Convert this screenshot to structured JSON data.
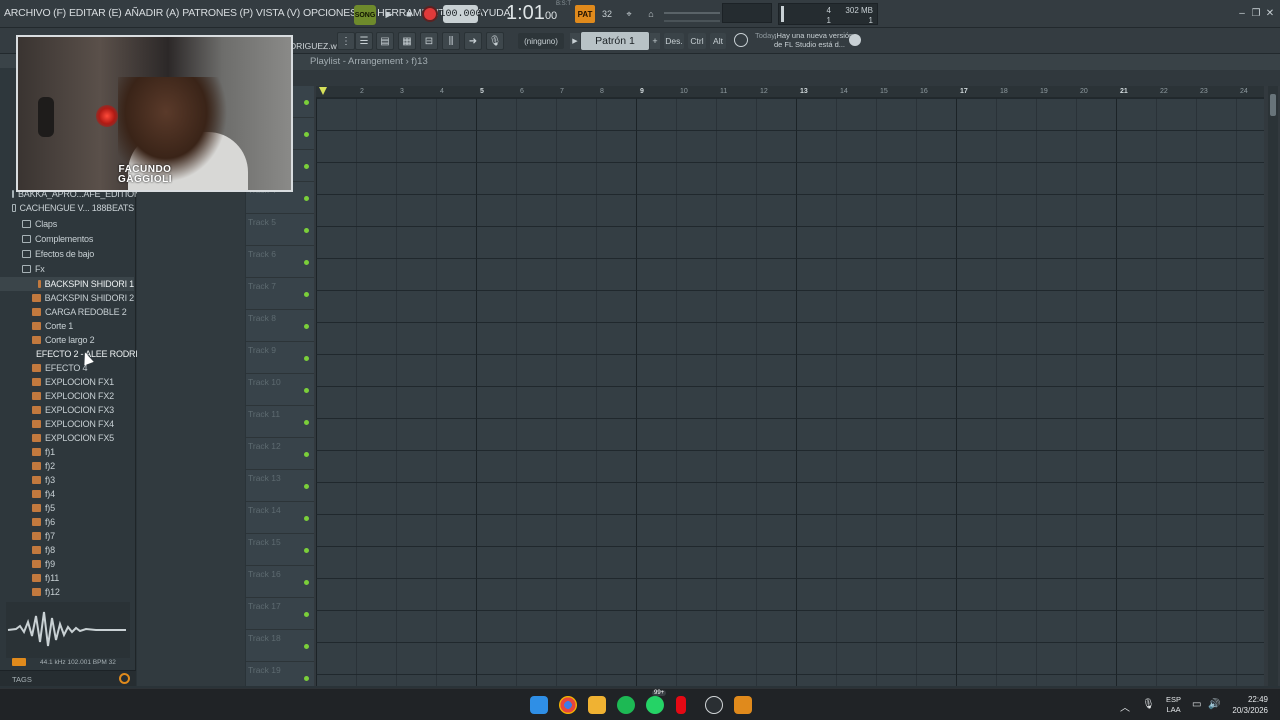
{
  "menu": [
    {
      "label": "ARCHIVO (F)"
    },
    {
      "label": "EDITAR (E)"
    },
    {
      "label": "AÑADIR (A)"
    },
    {
      "label": "PATRONES (P)"
    },
    {
      "label": "VISTA (V)"
    },
    {
      "label": "OPCIONES (O)"
    },
    {
      "label": "HERRAMIENTAS (T)"
    },
    {
      "label": "AYUDA"
    }
  ],
  "transport": {
    "song_label": "SONG",
    "tempo": "100.000",
    "time_main": "1:01",
    "time_sub": "00",
    "bst_label": "B:S:T",
    "metronome_label": "PAT",
    "pattern_count": "32",
    "cpu_value": "4",
    "polyphony": "1",
    "ram": "302 MB",
    "ram_sub": "1"
  },
  "toolbar2": {
    "hint_file": "DRIGUEZ.wav",
    "pattern_none": "(ninguno)",
    "pattern_name": "Patrón 1",
    "des_label": "Des.",
    "ctrl_label": "Ctrl",
    "alt_label": "Alt",
    "news_date": "Today",
    "news_text": "¡Hay una nueva versión de FL Studio está d..."
  },
  "webcam": {
    "name_line1": "FACUNDO",
    "name_line2": "GAGGIOLI"
  },
  "browser": {
    "items": [
      {
        "label": "BAKKA_APRO...AFE_EDITION",
        "type": "folder",
        "indent": 12
      },
      {
        "label": "CACHENGUE V... 188BEATS",
        "type": "folder",
        "indent": 12
      },
      {
        "label": "Claps",
        "type": "folder",
        "indent": 22
      },
      {
        "label": "Complementos",
        "type": "folder",
        "indent": 22
      },
      {
        "label": "Efectos de bajo",
        "type": "folder",
        "indent": 22
      },
      {
        "label": "Fx",
        "type": "folder",
        "indent": 22
      },
      {
        "label": "BACKSPIN SHIDORI 1",
        "type": "file",
        "indent": 38
      },
      {
        "label": "BACKSPIN SHIDORI 2",
        "type": "file",
        "indent": 32
      },
      {
        "label": "CARGA REDOBLE 2",
        "type": "file",
        "indent": 32
      },
      {
        "label": "Corte 1",
        "type": "file",
        "indent": 32
      },
      {
        "label": "Corte largo 2",
        "type": "file",
        "indent": 32
      },
      {
        "label": "EFECTO 2 - ALEE RODRIGUEZ",
        "type": "file",
        "indent": 32
      },
      {
        "label": "EFECTO 4",
        "type": "file",
        "indent": 32
      },
      {
        "label": "EXPLOCION FX1",
        "type": "file",
        "indent": 32
      },
      {
        "label": "EXPLOCION FX2",
        "type": "file",
        "indent": 32
      },
      {
        "label": "EXPLOCION FX3",
        "type": "file",
        "indent": 32
      },
      {
        "label": "EXPLOCION FX4",
        "type": "file",
        "indent": 32
      },
      {
        "label": "EXPLOCION FX5",
        "type": "file",
        "indent": 32
      },
      {
        "label": "f)1",
        "type": "file",
        "indent": 32
      },
      {
        "label": "f)2",
        "type": "file",
        "indent": 32
      },
      {
        "label": "f)3",
        "type": "file",
        "indent": 32
      },
      {
        "label": "f)4",
        "type": "file",
        "indent": 32
      },
      {
        "label": "f)5",
        "type": "file",
        "indent": 32
      },
      {
        "label": "f)6",
        "type": "file",
        "indent": 32
      },
      {
        "label": "f)7",
        "type": "file",
        "indent": 32
      },
      {
        "label": "f)8",
        "type": "file",
        "indent": 32
      },
      {
        "label": "f)9",
        "type": "file",
        "indent": 32
      },
      {
        "label": "f)11",
        "type": "file",
        "indent": 32
      },
      {
        "label": "f)12",
        "type": "file",
        "indent": 32
      }
    ],
    "wave_info": "44.1 kHz 102.001 BPM 32",
    "tags_label": "TAGS"
  },
  "playlist": {
    "title": "Playlist - Arrangement › f)13",
    "ruler": [
      "2",
      "3",
      "4",
      "5",
      "6",
      "7",
      "8",
      "9",
      "10",
      "11",
      "12",
      "13",
      "14",
      "15",
      "16",
      "17",
      "18",
      "19",
      "20",
      "21",
      "22",
      "23",
      "24"
    ],
    "major_bars": [
      "5",
      "9",
      "13",
      "17",
      "21"
    ],
    "tracks": [
      "",
      "",
      "",
      "Track 4",
      "Track 5",
      "Track 6",
      "Track 7",
      "Track 8",
      "Track 9",
      "Track 10",
      "Track 11",
      "Track 12",
      "Track 13",
      "Track 14",
      "Track 15",
      "Track 16",
      "Track 17",
      "Track 18",
      "Track 19"
    ]
  },
  "taskbar": {
    "lang_line1": "ESP",
    "lang_line2": "LAA",
    "time": "22:49",
    "date": "20/3/2026",
    "badge": "99+"
  },
  "colors": {
    "accent_orange": "#e08a1c",
    "song_green": "#6e8a2c",
    "record_red": "#e03a3a",
    "track_led": "#7bcf3a"
  }
}
